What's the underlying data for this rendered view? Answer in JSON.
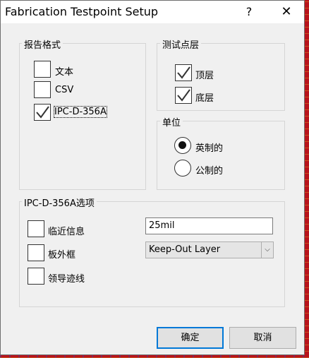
{
  "window": {
    "title": "Fabrication Testpoint Setup",
    "help_glyph": "?",
    "close_glyph": "✕"
  },
  "report_format": {
    "label": "报告格式",
    "options": [
      {
        "label": "文本",
        "checked": false
      },
      {
        "label": "CSV",
        "checked": false
      },
      {
        "label": "IPC-D-356A",
        "checked": true
      }
    ]
  },
  "test_layer": {
    "label": "测试点层",
    "options": [
      {
        "label": "顶层",
        "checked": true
      },
      {
        "label": "底层",
        "checked": true
      }
    ]
  },
  "units": {
    "label": "单位",
    "options": [
      {
        "label": "英制的",
        "selected": true
      },
      {
        "label": "公制的",
        "selected": false
      }
    ]
  },
  "ipc_options": {
    "label": "IPC-D-356A选项",
    "options": [
      {
        "label": "临近信息",
        "checked": false
      },
      {
        "label": "板外框",
        "checked": false
      },
      {
        "label": "领导迹线",
        "checked": false
      }
    ],
    "proximity_value": "25mil",
    "outline_layer": "Keep-Out Layer"
  },
  "buttons": {
    "ok": "确定",
    "cancel": "取消"
  },
  "colors": {
    "accent": "#0078d7",
    "background": "#f0f0f0"
  }
}
